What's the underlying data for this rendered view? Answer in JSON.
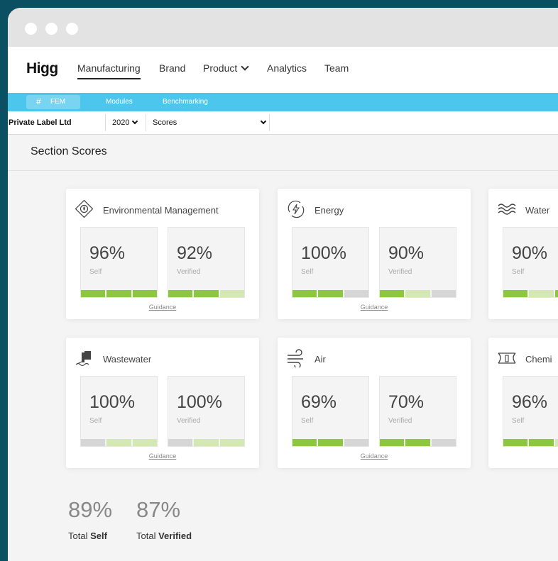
{
  "app": {
    "logo": "Higg"
  },
  "nav": {
    "items": [
      {
        "label": "Manufacturing"
      },
      {
        "label": "Brand"
      },
      {
        "label": "Product"
      },
      {
        "label": "Analytics"
      },
      {
        "label": "Team"
      }
    ]
  },
  "subnav": {
    "fem": "FEM",
    "modules": "Modules",
    "benchmarking": "Benchmarking"
  },
  "filters": {
    "company": "Private Label Ltd",
    "year": "2020",
    "view": "Scores"
  },
  "section": {
    "title": "Section Scores"
  },
  "colors": {
    "bar_full": "#8dc63f",
    "bar_light": "#d4e8b4",
    "bar_empty": "#d6d6d6",
    "accent": "#4cc6ec"
  },
  "cards": [
    {
      "title": "Environmental Management",
      "icon": "env-management-icon",
      "self": {
        "value": "96%",
        "label": "Self",
        "segments": [
          "full",
          "full",
          "full"
        ]
      },
      "verified": {
        "value": "92%",
        "label": "Verified",
        "segments": [
          "full",
          "full",
          "light"
        ]
      },
      "guidance": "Guidance"
    },
    {
      "title": "Energy",
      "icon": "energy-icon",
      "self": {
        "value": "100%",
        "label": "Self",
        "segments": [
          "full",
          "full",
          "empty"
        ]
      },
      "verified": {
        "value": "90%",
        "label": "Verified",
        "segments": [
          "full",
          "light",
          "empty"
        ]
      },
      "guidance": "Guidance"
    },
    {
      "title": "Water",
      "icon": "water-icon",
      "self": {
        "value": "90%",
        "label": "Self",
        "segments": [
          "full",
          "light",
          "full"
        ]
      },
      "verified": {
        "value": "",
        "label": "",
        "segments": []
      },
      "guidance": ""
    },
    {
      "title": "Wastewater",
      "icon": "wastewater-icon",
      "self": {
        "value": "100%",
        "label": "Self",
        "segments": [
          "empty",
          "light",
          "light"
        ]
      },
      "verified": {
        "value": "100%",
        "label": "Verified",
        "segments": [
          "empty",
          "light",
          "light"
        ]
      },
      "guidance": "Guidance"
    },
    {
      "title": "Air",
      "icon": "air-icon",
      "self": {
        "value": "69%",
        "label": "Self",
        "segments": [
          "full",
          "full",
          "empty"
        ]
      },
      "verified": {
        "value": "70%",
        "label": "Verified",
        "segments": [
          "full",
          "full",
          "empty"
        ]
      },
      "guidance": "Guidance"
    },
    {
      "title": "Chemi",
      "icon": "chemicals-icon",
      "self": {
        "value": "96%",
        "label": "Self",
        "segments": [
          "full",
          "full",
          "light"
        ]
      },
      "verified": {
        "value": "",
        "label": "",
        "segments": []
      },
      "guidance": ""
    }
  ],
  "totals": {
    "self_value": "89%",
    "self_prefix": "Total",
    "self_bold": "Self",
    "verified_value": "87%",
    "verified_prefix": "Total",
    "verified_bold": "Verified"
  }
}
